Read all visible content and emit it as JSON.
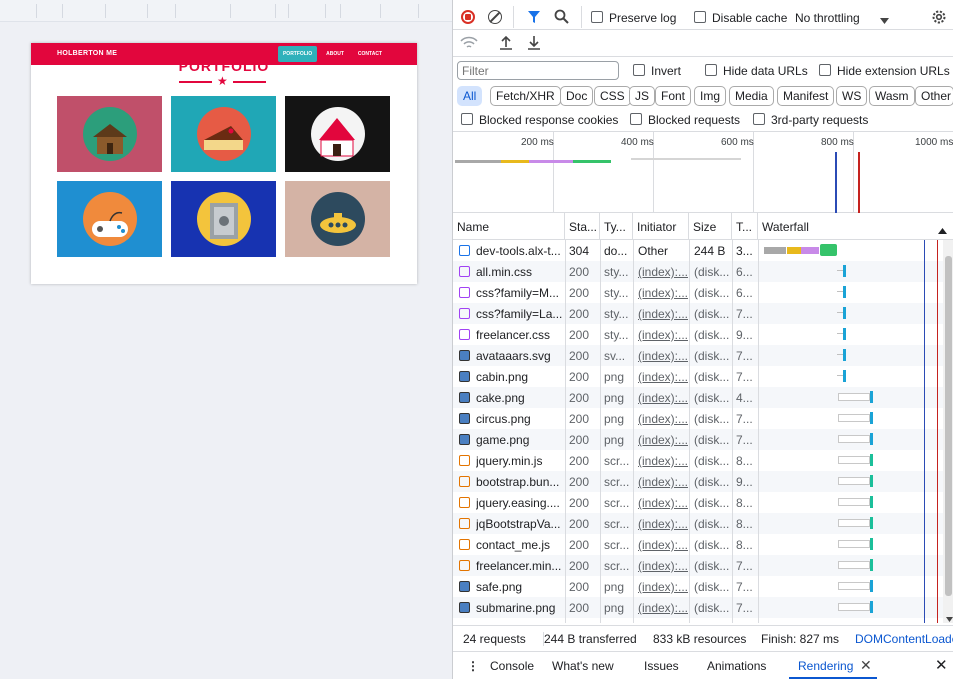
{
  "viewport": {
    "brand": "HOLBERTON ME",
    "nav_links": [
      {
        "label": "PORTFOLIO",
        "active": true
      },
      {
        "label": "ABOUT",
        "active": false
      },
      {
        "label": "CONTACT",
        "active": false
      }
    ],
    "heading": "PORTFOLIO",
    "tiles": [
      {
        "name": "cabin",
        "bg": "#c0506a",
        "circle": "#2c9e7b"
      },
      {
        "name": "cake",
        "bg": "#20a7b6",
        "circle": "#e65b45"
      },
      {
        "name": "circus",
        "bg": "#141414",
        "circle": "#f4f4f4"
      },
      {
        "name": "game",
        "bg": "#1f8fd1",
        "circle": "#f08a3c"
      },
      {
        "name": "safe",
        "bg": "#1733b1",
        "circle": "#f3c43c"
      },
      {
        "name": "submarine",
        "bg": "#d4b3a5",
        "circle": "#2d4a5e"
      }
    ],
    "accent": "#e2063d"
  },
  "toolbar": {
    "preserve_log": "Preserve log",
    "disable_cache": "Disable cache",
    "throttling": "No throttling"
  },
  "filter": {
    "placeholder": "Filter",
    "invert": "Invert",
    "hide_data_urls": "Hide data URLs",
    "hide_extension_urls": "Hide extension URLs"
  },
  "type_chips": [
    "All",
    "Fetch/XHR",
    "Doc",
    "CSS",
    "JS",
    "Font",
    "Img",
    "Media",
    "Manifest",
    "WS",
    "Wasm",
    "Other"
  ],
  "options": {
    "blocked_cookies": "Blocked response cookies",
    "blocked_requests": "Blocked requests",
    "third_party": "3rd-party requests"
  },
  "overview": {
    "ticks": [
      "200 ms",
      "400 ms",
      "600 ms",
      "800 ms",
      "1000 ms"
    ]
  },
  "columns": [
    "Name",
    "Sta...",
    "Ty...",
    "Initiator",
    "Size",
    "T...",
    "Waterfall"
  ],
  "rows": [
    {
      "name": "dev-tools.alx-t...",
      "status": "304",
      "type": "do...",
      "initiator": "Other",
      "size": "244 B",
      "time": "3...",
      "icon": "doc"
    },
    {
      "name": "all.min.css",
      "status": "200",
      "type": "sty...",
      "initiator": "(index):...",
      "size": "(disk...",
      "time": "6...",
      "icon": "css"
    },
    {
      "name": "css?family=M...",
      "status": "200",
      "type": "sty...",
      "initiator": "(index):...",
      "size": "(disk...",
      "time": "6...",
      "icon": "css"
    },
    {
      "name": "css?family=La...",
      "status": "200",
      "type": "sty...",
      "initiator": "(index):...",
      "size": "(disk...",
      "time": "7...",
      "icon": "css"
    },
    {
      "name": "freelancer.css",
      "status": "200",
      "type": "sty...",
      "initiator": "(index):...",
      "size": "(disk...",
      "time": "9...",
      "icon": "css"
    },
    {
      "name": "avataaars.svg",
      "status": "200",
      "type": "sv...",
      "initiator": "(index):...",
      "size": "(disk...",
      "time": "7...",
      "icon": "img"
    },
    {
      "name": "cabin.png",
      "status": "200",
      "type": "png",
      "initiator": "(index):...",
      "size": "(disk...",
      "time": "7...",
      "icon": "img"
    },
    {
      "name": "cake.png",
      "status": "200",
      "type": "png",
      "initiator": "(index):...",
      "size": "(disk...",
      "time": "4...",
      "icon": "img"
    },
    {
      "name": "circus.png",
      "status": "200",
      "type": "png",
      "initiator": "(index):...",
      "size": "(disk...",
      "time": "7...",
      "icon": "img"
    },
    {
      "name": "game.png",
      "status": "200",
      "type": "png",
      "initiator": "(index):...",
      "size": "(disk...",
      "time": "7...",
      "icon": "img"
    },
    {
      "name": "jquery.min.js",
      "status": "200",
      "type": "scr...",
      "initiator": "(index):...",
      "size": "(disk...",
      "time": "8...",
      "icon": "js"
    },
    {
      "name": "bootstrap.bun...",
      "status": "200",
      "type": "scr...",
      "initiator": "(index):...",
      "size": "(disk...",
      "time": "9...",
      "icon": "js"
    },
    {
      "name": "jquery.easing....",
      "status": "200",
      "type": "scr...",
      "initiator": "(index):...",
      "size": "(disk...",
      "time": "8...",
      "icon": "js"
    },
    {
      "name": "jqBootstrapVa...",
      "status": "200",
      "type": "scr...",
      "initiator": "(index):...",
      "size": "(disk...",
      "time": "8...",
      "icon": "js"
    },
    {
      "name": "contact_me.js",
      "status": "200",
      "type": "scr...",
      "initiator": "(index):...",
      "size": "(disk...",
      "time": "8...",
      "icon": "js"
    },
    {
      "name": "freelancer.min...",
      "status": "200",
      "type": "scr...",
      "initiator": "(index):...",
      "size": "(disk...",
      "time": "7...",
      "icon": "js"
    },
    {
      "name": "safe.png",
      "status": "200",
      "type": "png",
      "initiator": "(index):...",
      "size": "(disk...",
      "time": "7...",
      "icon": "img"
    },
    {
      "name": "submarine.png",
      "status": "200",
      "type": "png",
      "initiator": "(index):...",
      "size": "(disk...",
      "time": "7...",
      "icon": "img"
    }
  ],
  "summary": {
    "requests": "24 requests",
    "transferred": "244 B transferred",
    "resources": "833 kB resources",
    "finish": "Finish: 827 ms",
    "dcl": "DOMContentLoade"
  },
  "drawer_tabs": [
    "Console",
    "What's new",
    "Issues",
    "Animations",
    "Rendering"
  ],
  "colors": {
    "record_red": "#d93025",
    "link_blue": "#0b57d0",
    "css_icon": "#a142f4",
    "js_icon": "#e37400",
    "doc_icon": "#1a73e8"
  }
}
